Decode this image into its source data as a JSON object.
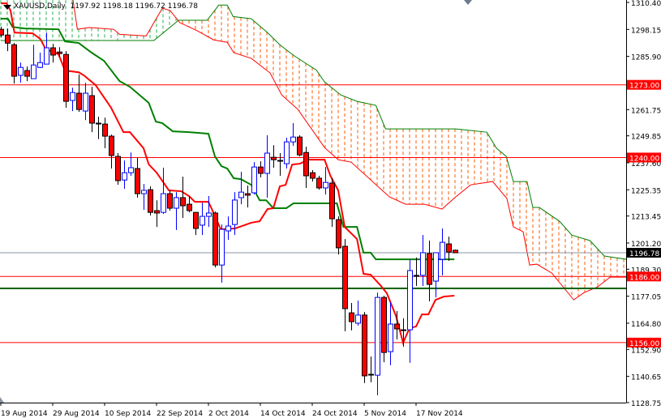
{
  "header": {
    "symbol": "XAUUSD,Daily",
    "ohlc": "1197.92 1198.18 1196.72 1196.78"
  },
  "colors": {
    "bull": "#0000ff",
    "bear": "#ff0000",
    "tenkan": "#ff0000",
    "kijun": "#008000",
    "span_a": "#008000",
    "span_b": "#ff0000",
    "cloud_bull": "#22b24c",
    "cloud_bear": "#ff5a00",
    "level_red": "#ff0000",
    "level_green": "#006400",
    "price_line": "#8a94a0"
  },
  "chart_data": {
    "type": "candlestick",
    "title": "XAUUSD,Daily",
    "ylim": [
      1128.75,
      1310.4
    ],
    "y_ticks": [
      "1310.40",
      "1298.15",
      "1285.90",
      "1273.00",
      "1261.75",
      "1249.85",
      "1237.60",
      "1225.35",
      "1213.45",
      "1201.20",
      "1189.30",
      "1177.05",
      "1164.80",
      "1152.90",
      "1140.65",
      "1128.75"
    ],
    "x_ticks": [
      {
        "bar": 0,
        "label": "19 Aug 2014"
      },
      {
        "bar": 8,
        "label": "29 Aug 2014"
      },
      {
        "bar": 16,
        "label": "10 Sep 2014"
      },
      {
        "bar": 24,
        "label": "22 Sep 2014"
      },
      {
        "bar": 32,
        "label": "2 Oct 2014"
      },
      {
        "bar": 40,
        "label": "14 Oct 2014"
      },
      {
        "bar": 48,
        "label": "24 Oct 2014"
      },
      {
        "bar": 56,
        "label": "5 Nov 2014"
      },
      {
        "bar": 64,
        "label": "17 Nov 2014"
      }
    ],
    "candles_ohlc": [
      [
        1298.2,
        1299.3,
        1294.5,
        1295.6
      ],
      [
        1295.6,
        1298.6,
        1288.3,
        1291.9
      ],
      [
        1291.2,
        1292.0,
        1273.6,
        1276.9
      ],
      [
        1277.3,
        1283.1,
        1274.0,
        1280.9
      ],
      [
        1279.5,
        1281.3,
        1274.7,
        1276.9
      ],
      [
        1275.8,
        1291.2,
        1275.8,
        1282.0
      ],
      [
        1280.9,
        1287.6,
        1280.6,
        1283.1
      ],
      [
        1282.4,
        1296.7,
        1282.4,
        1289.8
      ],
      [
        1289.8,
        1291.6,
        1283.1,
        1286.5
      ],
      [
        1287.9,
        1290.1,
        1285.7,
        1287.2
      ],
      [
        1286.8,
        1288.3,
        1262.6,
        1265.5
      ],
      [
        1265.9,
        1271.7,
        1261.1,
        1269.5
      ],
      [
        1269.2,
        1277.7,
        1260.7,
        1261.8
      ],
      [
        1261.1,
        1273.9,
        1257.0,
        1269.2
      ],
      [
        1268.1,
        1272.1,
        1251.5,
        1255.6
      ],
      [
        1255.6,
        1258.5,
        1248.4,
        1255.6
      ],
      [
        1255.2,
        1258.1,
        1244.2,
        1249.7
      ],
      [
        1249.7,
        1250.4,
        1235.0,
        1240.9
      ],
      [
        1240.5,
        1242.0,
        1227.6,
        1229.5
      ],
      [
        1229.8,
        1238.7,
        1225.8,
        1233.1
      ],
      [
        1233.1,
        1242.3,
        1231.7,
        1235.4
      ],
      [
        1235.0,
        1239.8,
        1221.8,
        1223.6
      ],
      [
        1223.6,
        1228.0,
        1216.2,
        1225.1
      ],
      [
        1225.4,
        1226.9,
        1213.7,
        1215.1
      ],
      [
        1215.9,
        1220.6,
        1208.5,
        1214.8
      ],
      [
        1215.1,
        1235.4,
        1214.4,
        1223.6
      ],
      [
        1223.6,
        1225.1,
        1215.9,
        1217.0
      ],
      [
        1217.0,
        1224.3,
        1207.1,
        1221.8
      ],
      [
        1221.8,
        1231.3,
        1212.6,
        1218.1
      ],
      [
        1218.8,
        1222.5,
        1215.1,
        1215.9
      ],
      [
        1215.1,
        1215.1,
        1204.8,
        1207.8
      ],
      [
        1209.3,
        1219.5,
        1204.8,
        1213.3
      ],
      [
        1213.3,
        1222.5,
        1208.5,
        1214.8
      ],
      [
        1214.8,
        1215.5,
        1190.1,
        1191.2
      ],
      [
        1191.2,
        1209.6,
        1183.2,
        1207.4
      ],
      [
        1206.7,
        1213.3,
        1202.6,
        1208.9
      ],
      [
        1209.6,
        1224.3,
        1204.8,
        1220.7
      ],
      [
        1221.8,
        1233.5,
        1218.8,
        1224.3
      ],
      [
        1223.6,
        1227.3,
        1217.3,
        1222.9
      ],
      [
        1224.0,
        1237.9,
        1223.2,
        1235.7
      ],
      [
        1235.7,
        1238.3,
        1231.0,
        1232.8
      ],
      [
        1232.8,
        1250.1,
        1221.8,
        1242.0
      ],
      [
        1240.1,
        1245.6,
        1235.4,
        1239.0
      ],
      [
        1238.7,
        1242.0,
        1231.7,
        1238.7
      ],
      [
        1237.2,
        1249.0,
        1235.0,
        1247.1
      ],
      [
        1247.1,
        1255.6,
        1245.3,
        1249.3
      ],
      [
        1249.3,
        1250.1,
        1240.5,
        1241.2
      ],
      [
        1242.3,
        1244.9,
        1226.2,
        1231.7
      ],
      [
        1233.1,
        1234.3,
        1229.1,
        1230.6
      ],
      [
        1230.6,
        1231.7,
        1225.4,
        1226.2
      ],
      [
        1226.2,
        1235.7,
        1223.2,
        1228.7
      ],
      [
        1228.4,
        1230.6,
        1208.5,
        1212.2
      ],
      [
        1211.8,
        1213.3,
        1196.0,
        1199.0
      ],
      [
        1199.7,
        1203.0,
        1161.1,
        1171.4
      ],
      [
        1169.5,
        1174.0,
        1161.5,
        1165.5
      ],
      [
        1164.8,
        1175.1,
        1163.7,
        1168.5
      ],
      [
        1168.5,
        1169.9,
        1137.6,
        1140.9
      ],
      [
        1141.6,
        1149.7,
        1138.0,
        1141.6
      ],
      [
        1141.2,
        1178.7,
        1132.1,
        1176.5
      ],
      [
        1176.5,
        1177.3,
        1147.1,
        1151.5
      ],
      [
        1151.9,
        1174.3,
        1145.7,
        1164.4
      ],
      [
        1164.4,
        1170.3,
        1157.4,
        1162.2
      ],
      [
        1161.8,
        1167.0,
        1154.1,
        1161.8
      ],
      [
        1161.8,
        1193.8,
        1146.8,
        1188.7
      ],
      [
        1186.5,
        1194.6,
        1181.7,
        1186.5
      ],
      [
        1186.5,
        1204.8,
        1181.7,
        1196.8
      ],
      [
        1196.4,
        1202.3,
        1174.7,
        1182.4
      ],
      [
        1183.9,
        1196.8,
        1176.5,
        1196.8
      ],
      [
        1193.8,
        1207.8,
        1186.5,
        1201.5
      ],
      [
        1200.8,
        1204.1,
        1193.1,
        1197.1
      ],
      [
        1197.92,
        1198.18,
        1196.72,
        1196.78
      ]
    ],
    "tenkan": [
      [
        0,
        1310.0
      ],
      [
        0.9,
        1310.0
      ],
      [
        1.5,
        1306.7
      ],
      [
        2.1,
        1296.7
      ],
      [
        4.9,
        1296.4
      ],
      [
        6.1,
        1293.8
      ],
      [
        7.0,
        1288.7
      ],
      [
        8.0,
        1288.3
      ],
      [
        8.9,
        1286.8
      ],
      [
        9.9,
        1279.5
      ],
      [
        12,
        1278.7
      ],
      [
        12.8,
        1277.3
      ],
      [
        14.6,
        1272.9
      ],
      [
        17,
        1262.6
      ],
      [
        18.9,
        1251.5
      ],
      [
        19.9,
        1251.5
      ],
      [
        22,
        1244.2
      ],
      [
        22.8,
        1236.9
      ],
      [
        24,
        1233.2
      ],
      [
        25.9,
        1225.1
      ],
      [
        27.8,
        1224.7
      ],
      [
        29,
        1222.5
      ],
      [
        29.9,
        1219.9
      ],
      [
        32,
        1219.9
      ],
      [
        32.8,
        1214.8
      ],
      [
        33.9,
        1207.4
      ],
      [
        36.1,
        1207.8
      ],
      [
        38.6,
        1210.4
      ],
      [
        39.9,
        1211.1
      ],
      [
        41.1,
        1216.6
      ],
      [
        42,
        1217.0
      ],
      [
        43,
        1226.9
      ],
      [
        43.9,
        1227.6
      ],
      [
        44.9,
        1236.8
      ],
      [
        46.1,
        1237.2
      ],
      [
        47.4,
        1239.0
      ],
      [
        49.9,
        1239.0
      ],
      [
        50.8,
        1231.7
      ],
      [
        52,
        1225.1
      ],
      [
        53,
        1208.5
      ],
      [
        54.9,
        1203.0
      ],
      [
        55.9,
        1187.2
      ],
      [
        57,
        1186.8
      ],
      [
        58.6,
        1181.7
      ],
      [
        59.5,
        1178.4
      ],
      [
        60.9,
        1168.1
      ],
      [
        62,
        1155.9
      ],
      [
        63,
        1162.6
      ],
      [
        64,
        1163.3
      ],
      [
        64.9,
        1168.8
      ],
      [
        65.9,
        1168.8
      ],
      [
        67,
        1175.4
      ],
      [
        68.3,
        1176.9
      ],
      [
        69.9,
        1177.3
      ]
    ],
    "kijun": [
      [
        0,
        1303.0
      ],
      [
        1.1,
        1303.0
      ],
      [
        1.8,
        1299.3
      ],
      [
        3.6,
        1298.6
      ],
      [
        8.9,
        1298.2
      ],
      [
        9.9,
        1292.7
      ],
      [
        12,
        1292.0
      ],
      [
        14,
        1287.6
      ],
      [
        15.9,
        1283.9
      ],
      [
        18.3,
        1274.7
      ],
      [
        19.9,
        1272.1
      ],
      [
        22.8,
        1264.8
      ],
      [
        23.9,
        1256.3
      ],
      [
        24.9,
        1255.6
      ],
      [
        26.5,
        1251.9
      ],
      [
        29,
        1251.5
      ],
      [
        32,
        1250.8
      ],
      [
        33,
        1240.5
      ],
      [
        34,
        1236.1
      ],
      [
        34.9,
        1235.0
      ],
      [
        35.9,
        1230.6
      ],
      [
        37,
        1230.2
      ],
      [
        38.6,
        1227.6
      ],
      [
        39.9,
        1220.6
      ],
      [
        40.9,
        1220.6
      ],
      [
        42,
        1217.0
      ],
      [
        44,
        1217.0
      ],
      [
        45.1,
        1219.2
      ],
      [
        51.8,
        1219.2
      ],
      [
        52.8,
        1208.5
      ],
      [
        54.9,
        1208.5
      ],
      [
        55.9,
        1196.8
      ],
      [
        57,
        1196.8
      ],
      [
        57.8,
        1193.8
      ],
      [
        69.9,
        1193.8
      ]
    ],
    "senkou_a": [
      [
        0,
        1293.1
      ],
      [
        23.6,
        1293.1
      ],
      [
        27.4,
        1302.3
      ],
      [
        31.8,
        1302.3
      ],
      [
        33.6,
        1309.2
      ],
      [
        34.9,
        1309.2
      ],
      [
        35.8,
        1304.0
      ],
      [
        38.6,
        1303.0
      ],
      [
        41.1,
        1296.7
      ],
      [
        43,
        1291.2
      ],
      [
        45.1,
        1286.4
      ],
      [
        47.4,
        1282.0
      ],
      [
        48.6,
        1279.8
      ],
      [
        49.9,
        1274.3
      ],
      [
        52.4,
        1268.4
      ],
      [
        54.9,
        1265.5
      ],
      [
        57.8,
        1263.7
      ],
      [
        59.3,
        1253.0
      ],
      [
        70.1,
        1253.0
      ],
      [
        74.9,
        1251.5
      ],
      [
        76.4,
        1244.2
      ],
      [
        77.9,
        1240.5
      ],
      [
        79,
        1229.1
      ],
      [
        81.1,
        1229.1
      ],
      [
        82,
        1217.3
      ],
      [
        83,
        1217.3
      ],
      [
        86.1,
        1211.1
      ],
      [
        88,
        1204.8
      ],
      [
        90.8,
        1202.3
      ],
      [
        93,
        1195.3
      ],
      [
        96.4,
        1193.8
      ]
    ],
    "senkou_b": [
      [
        0,
        1314.0
      ],
      [
        11,
        1314.0
      ],
      [
        11.8,
        1298.2
      ],
      [
        13.6,
        1299.0
      ],
      [
        17.4,
        1298.2
      ],
      [
        18.3,
        1295.9
      ],
      [
        22.4,
        1295.2
      ],
      [
        24.9,
        1307.8
      ],
      [
        26.1,
        1306.7
      ],
      [
        27.6,
        1301.2
      ],
      [
        30.3,
        1297.5
      ],
      [
        32.8,
        1293.4
      ],
      [
        34.9,
        1292.3
      ],
      [
        35.9,
        1287.6
      ],
      [
        38.6,
        1285.0
      ],
      [
        41.5,
        1278.4
      ],
      [
        43.3,
        1268.4
      ],
      [
        45.8,
        1261.8
      ],
      [
        49.9,
        1244.5
      ],
      [
        52,
        1239.0
      ],
      [
        54,
        1237.9
      ],
      [
        59.9,
        1222.1
      ],
      [
        62.4,
        1218.8
      ],
      [
        65.3,
        1218.8
      ],
      [
        68,
        1216.6
      ],
      [
        70.1,
        1222.1
      ],
      [
        72.4,
        1227.6
      ],
      [
        75.8,
        1229.1
      ],
      [
        78,
        1221.4
      ],
      [
        79,
        1208.5
      ],
      [
        80.5,
        1206.3
      ],
      [
        81.5,
        1191.2
      ],
      [
        82.6,
        1191.6
      ],
      [
        84.9,
        1187.6
      ],
      [
        88.3,
        1175.4
      ],
      [
        89.9,
        1178.7
      ],
      [
        92,
        1181.3
      ],
      [
        93.9,
        1185.7
      ],
      [
        96.4,
        1185.7
      ]
    ],
    "levels": [
      {
        "price": 1273.0,
        "label": "1273.00",
        "color": "#ff0000"
      },
      {
        "price": 1240.0,
        "label": "1240.00",
        "color": "#ff0000"
      },
      {
        "price": 1186.0,
        "label": "1186.00",
        "color": "#ff0000"
      },
      {
        "price": 1156.0,
        "label": "1156.00",
        "color": "#ff0000"
      },
      {
        "price": 1180.6,
        "label": "",
        "color": "#006400"
      }
    ],
    "current_price": {
      "price": 1196.78,
      "label": "1196.78"
    }
  }
}
